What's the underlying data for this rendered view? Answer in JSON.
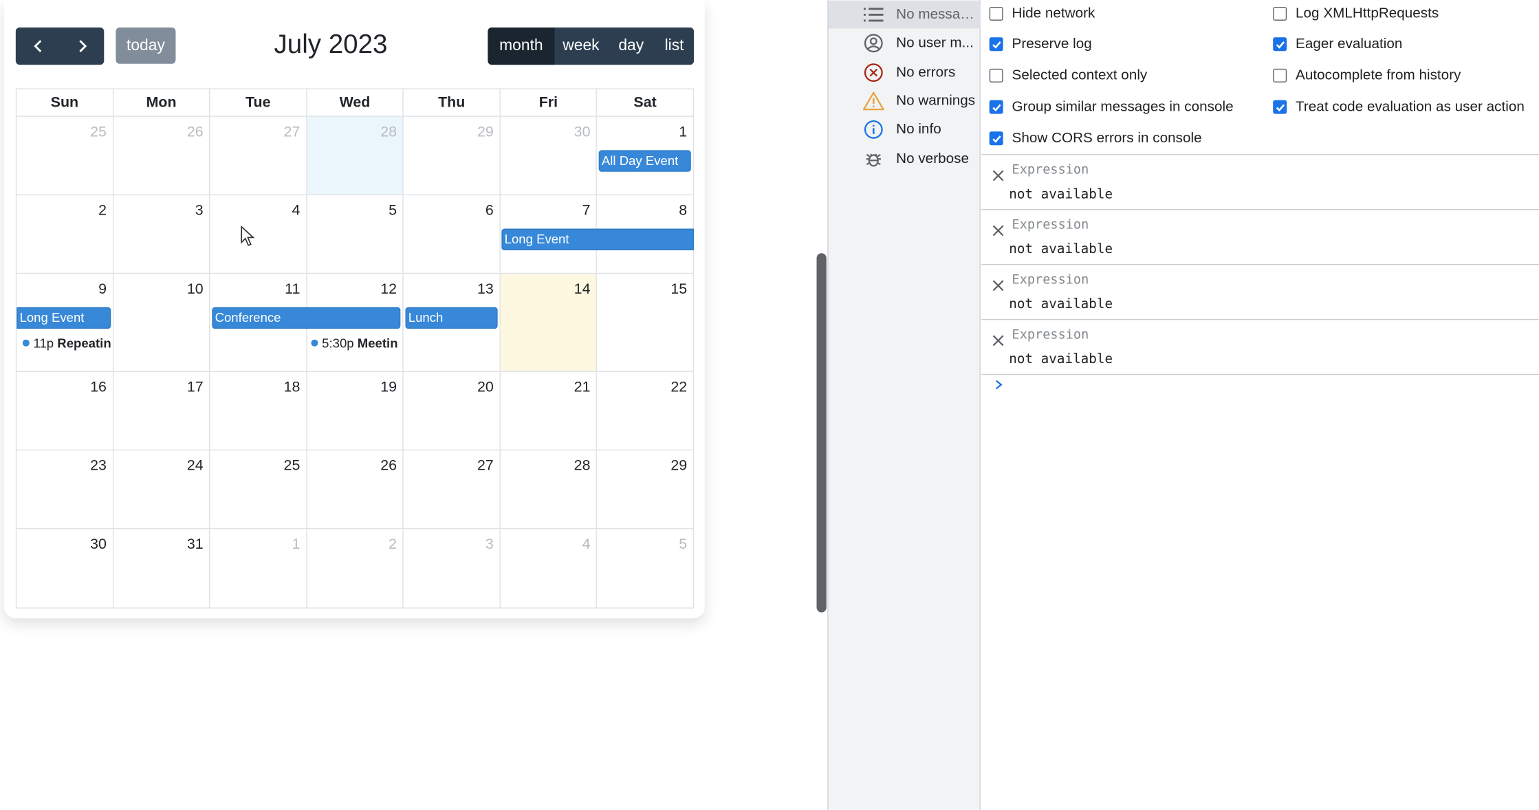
{
  "calendar": {
    "title": "July 2023",
    "today_label": "today",
    "views": [
      "month",
      "week",
      "day",
      "list"
    ],
    "active_view": "month",
    "weekdays": [
      "Sun",
      "Mon",
      "Tue",
      "Wed",
      "Thu",
      "Fri",
      "Sat"
    ],
    "weeks": [
      [
        "25",
        "26",
        "27",
        "28",
        "29",
        "30",
        "1"
      ],
      [
        "2",
        "3",
        "4",
        "5",
        "6",
        "7",
        "8"
      ],
      [
        "9",
        "10",
        "11",
        "12",
        "13",
        "14",
        "15"
      ],
      [
        "16",
        "17",
        "18",
        "19",
        "20",
        "21",
        "22"
      ],
      [
        "23",
        "24",
        "25",
        "26",
        "27",
        "28",
        "29"
      ],
      [
        "30",
        "31",
        "1",
        "2",
        "3",
        "4",
        "5"
      ]
    ],
    "events": {
      "all_day": "All Day Event",
      "long_event_1": "Long Event",
      "long_event_2": "Long Event",
      "conference": "Conference",
      "lunch": "Lunch",
      "repeating_time": "11p",
      "repeating_title": "Repeatin",
      "meeting_time": "5:30p",
      "meeting_title": "Meetin"
    },
    "colors": {
      "event": "#3788d8",
      "today_bg": "#fef8e1",
      "selected_bg": "#eaf6fb",
      "toolbar": "#2c3e50"
    }
  },
  "devtools": {
    "sidebar": [
      {
        "label": "No messag...",
        "icon": "list-icon"
      },
      {
        "label": "No user m...",
        "icon": "user-circle-icon"
      },
      {
        "label": "No errors",
        "icon": "error-icon"
      },
      {
        "label": "No warnings",
        "icon": "warning-icon"
      },
      {
        "label": "No info",
        "icon": "info-icon"
      },
      {
        "label": "No verbose",
        "icon": "bug-icon"
      }
    ],
    "settings": [
      {
        "label": "Hide network",
        "checked": false
      },
      {
        "label": "Log XMLHttpRequests",
        "checked": false
      },
      {
        "label": "Preserve log",
        "checked": true
      },
      {
        "label": "Eager evaluation",
        "checked": true
      },
      {
        "label": "Selected context only",
        "checked": false
      },
      {
        "label": "Autocomplete from history",
        "checked": false
      },
      {
        "label": "Group similar messages in console",
        "checked": true
      },
      {
        "label": "Treat code evaluation as user action",
        "checked": true
      },
      {
        "label": "Show CORS errors in console",
        "checked": true
      }
    ],
    "expressions": [
      {
        "name": "Expression",
        "value": "not available"
      },
      {
        "name": "Expression",
        "value": "not available"
      },
      {
        "name": "Expression",
        "value": "not available"
      },
      {
        "name": "Expression",
        "value": "not available"
      }
    ]
  }
}
